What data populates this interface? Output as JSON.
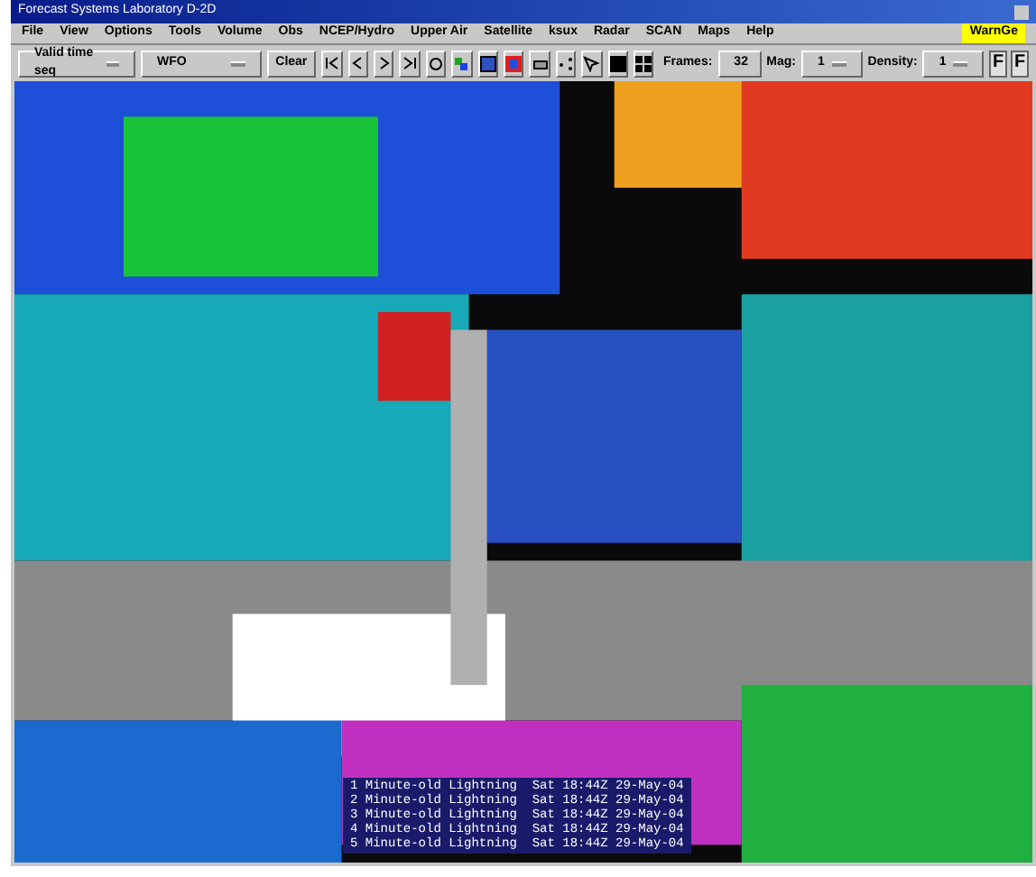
{
  "window": {
    "title": "Forecast Systems Laboratory D-2D"
  },
  "menu": [
    "File",
    "View",
    "Options",
    "Tools",
    "Volume",
    "Obs",
    "NCEP/Hydro",
    "Upper Air",
    "Satellite",
    "ksux",
    "Radar",
    "SCAN",
    "Maps",
    "Help"
  ],
  "warngen_button": "WarnGe",
  "toolbar": {
    "time_mode": "Valid time seq",
    "scale": "WFO",
    "clear": "Clear",
    "frames_label": "Frames:",
    "frames": "32",
    "mag_label": "Mag:",
    "mag": "1",
    "density_label": "Density:",
    "density": "1",
    "right_buttons": [
      "F",
      "F"
    ]
  },
  "legend": [
    "1 Minute-old Lightning  Sat 18:44Z 29-May-04",
    "2 Minute-old Lightning  Sat 18:44Z 29-May-04",
    "3 Minute-old Lightning  Sat 18:44Z 29-May-04",
    "4 Minute-old Lightning  Sat 18:44Z 29-May-04",
    "5 Minute-old Lightning  Sat 18:44Z 29-May-04"
  ]
}
